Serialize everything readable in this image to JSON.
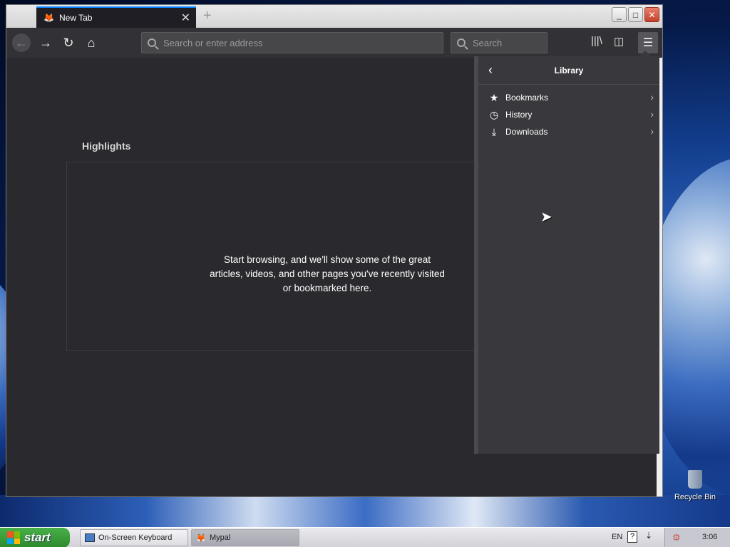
{
  "browser": {
    "tab_title": "New Tab",
    "url_placeholder": "Search or enter address",
    "search_placeholder": "Search"
  },
  "newtab": {
    "highlights_title": "Highlights",
    "highlights_message": "Start browsing, and we'll show some of the great articles, videos, and other pages you've recently visited or bookmarked here."
  },
  "library_panel": {
    "title": "Library",
    "items": [
      {
        "label": "Bookmarks",
        "icon": "star-icon"
      },
      {
        "label": "History",
        "icon": "clock-icon"
      },
      {
        "label": "Downloads",
        "icon": "download-icon"
      }
    ]
  },
  "desktop": {
    "recycle_bin_label": "Recycle Bin"
  },
  "taskbar": {
    "start_label": "start",
    "tasks": [
      {
        "label": "On-Screen Keyboard"
      },
      {
        "label": "Mypal"
      }
    ],
    "language": "EN",
    "clock": "3:06"
  }
}
